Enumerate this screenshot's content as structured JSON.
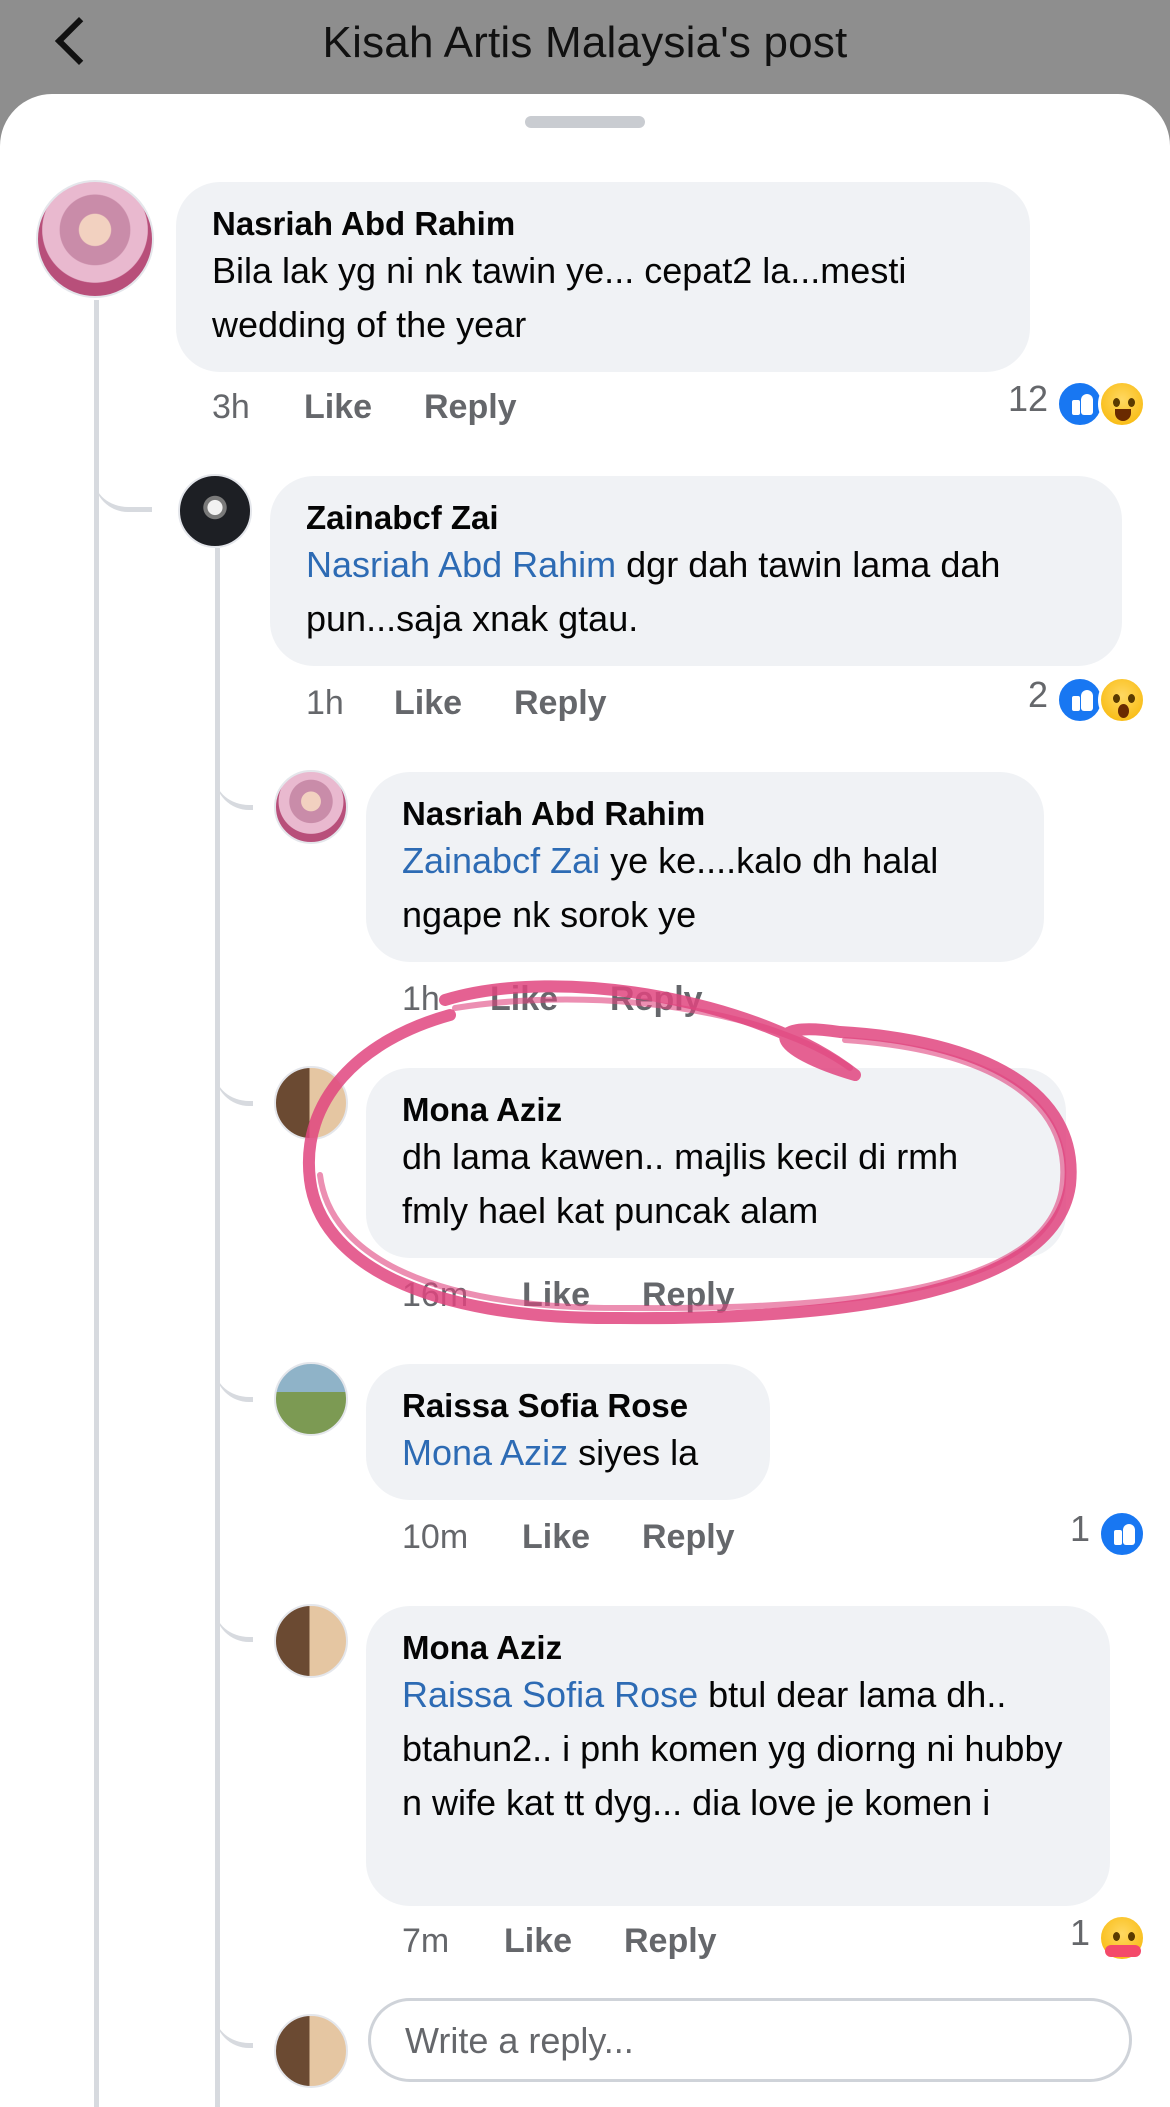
{
  "header": {
    "title": "Kisah Artis Malaysia's post"
  },
  "labels": {
    "like": "Like",
    "reply": "Reply"
  },
  "comments": [
    {
      "name": "Nasriah Abd Rahim",
      "mention": "",
      "text": "Bila lak yg ni nk tawin ye... cepat2 la...mesti wedding of the year",
      "time": "3h",
      "reactions": "12"
    },
    {
      "name": "Zainabcf Zai",
      "mention": "Nasriah Abd Rahim",
      "text": " dgr dah tawin lama dah pun...saja xnak gtau.",
      "time": "1h",
      "reactions": "2"
    },
    {
      "name": "Nasriah Abd Rahim",
      "mention": "Zainabcf Zai",
      "text": " ye ke....kalo dh halal ngape nk sorok ye",
      "time": "1h",
      "reactions": ""
    },
    {
      "name": "Mona Aziz",
      "mention": "",
      "text": "dh lama kawen.. majlis kecil di rmh fmly hael kat puncak alam",
      "time": "16m",
      "reactions": ""
    },
    {
      "name": "Raissa Sofia Rose",
      "mention": "Mona Aziz",
      "text": " siyes la",
      "time": "10m",
      "reactions": "1"
    },
    {
      "name": "Mona Aziz",
      "mention": "Raissa Sofia Rose",
      "text": " btul dear lama dh.. btahun2.. i pnh komen yg diorng ni hubby n wife kat tt dyg... dia love je komen i",
      "time": "7m",
      "reactions": "1"
    }
  ],
  "reply_box": {
    "placeholder": "Write a reply..."
  },
  "colors": {
    "mention": "#2d6bb4",
    "like": "#1877f2",
    "bubble": "#f0f2f5",
    "scribble": "#e0457f"
  }
}
